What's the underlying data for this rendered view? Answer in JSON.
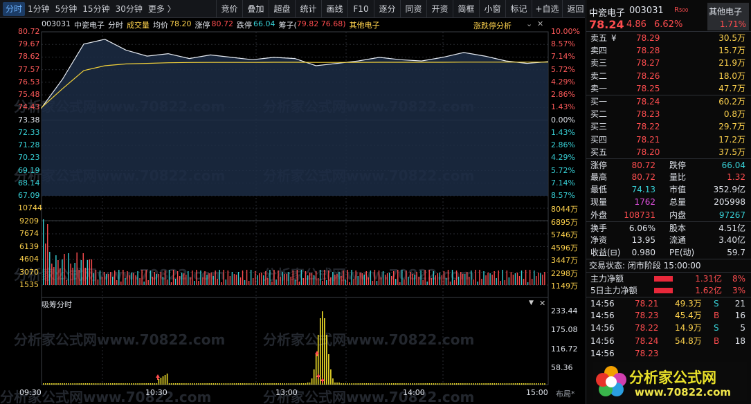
{
  "toolbar": {
    "tabs": [
      "分时",
      "1分钟",
      "5分钟",
      "15分钟",
      "30分钟",
      "更多 〉"
    ],
    "tools": [
      "竞价",
      "叠加",
      "超盘",
      "统计",
      "画线",
      "F10",
      "逐分",
      "同资",
      "开资",
      "简框",
      "小窗",
      "标记",
      "+自选",
      "返回"
    ]
  },
  "info": {
    "code": "003031",
    "name": "中瓷电子",
    "mode": "分时",
    "vol_label": "成交量",
    "avg_label": "均价",
    "avg": "78.20",
    "limit_up_label": "涨停",
    "limit_up": "80.72",
    "limit_down_label": "跌停",
    "limit_down": "66.04",
    "chip_label": "筹子(",
    "chip": "79.82 76.68)",
    "sector": "其他电子",
    "btn": "涨跌停分析"
  },
  "price_axis": {
    "left": [
      "80.72",
      "79.67",
      "78.62",
      "77.57",
      "76.53",
      "75.48",
      "74.43",
      "73.38",
      "72.33",
      "71.28",
      "70.23",
      "69.19",
      "68.14",
      "67.09"
    ],
    "right": [
      "10.00%",
      "8.57%",
      "7.14%",
      "5.72%",
      "4.29%",
      "2.86%",
      "1.43%",
      "0.00%",
      "1.43%",
      "2.86%",
      "4.29%",
      "5.72%",
      "7.14%",
      "8.57%"
    ]
  },
  "vol_axis": {
    "left": [
      "10744",
      "9209",
      "7674",
      "6139",
      "4604",
      "3070",
      "1535"
    ],
    "right": [
      "8044万",
      "6895万",
      "5746万",
      "4596万",
      "3447万",
      "2298万",
      "1149万"
    ]
  },
  "chip_panel": {
    "title": "吸筹分时",
    "axis": [
      "233.44",
      "175.08",
      "116.72",
      "58.36"
    ]
  },
  "time_axis": [
    "09:30",
    "10:30",
    "13:00",
    "14:00",
    "15:00"
  ],
  "layout_btn": "布局*",
  "watermark": "分析家公式网www.70822.com",
  "logo_text": "分析家公式网",
  "logo_url": "www.70822.com",
  "stock": {
    "name": "中瓷电子",
    "code": "003031",
    "tag": "R",
    "tag2": "500",
    "price": "78.24",
    "change": "4.86",
    "pct": "6.62%",
    "sector": "其他电子",
    "sector_pct": "1.71%"
  },
  "asks": [
    {
      "l": "卖五",
      "p": "78.29",
      "v": "30.5万",
      "mark": "¥"
    },
    {
      "l": "卖四",
      "p": "78.28",
      "v": "15.7万"
    },
    {
      "l": "卖三",
      "p": "78.27",
      "v": "21.9万"
    },
    {
      "l": "卖二",
      "p": "78.26",
      "v": "18.0万"
    },
    {
      "l": "卖一",
      "p": "78.25",
      "v": "47.7万"
    }
  ],
  "bids": [
    {
      "l": "买一",
      "p": "78.24",
      "v": "60.2万"
    },
    {
      "l": "买二",
      "p": "78.23",
      "v": "0.8万"
    },
    {
      "l": "买三",
      "p": "78.22",
      "v": "29.7万"
    },
    {
      "l": "买四",
      "p": "78.21",
      "v": "17.2万"
    },
    {
      "l": "买五",
      "p": "78.20",
      "v": "37.5万"
    }
  ],
  "stats": [
    [
      "涨停",
      "80.72",
      "跌停",
      "66.04"
    ],
    [
      "最高",
      "80.72",
      "量比",
      "1.32"
    ],
    [
      "最低",
      "74.13",
      "市值",
      "352.9亿"
    ],
    [
      "现量",
      "1762",
      "总量",
      "205998"
    ],
    [
      "外盘",
      "108731",
      "内盘",
      "97267"
    ]
  ],
  "stats2": [
    [
      "换手",
      "6.06%",
      "股本",
      "4.51亿"
    ],
    [
      "净资",
      "13.95",
      "流通",
      "3.40亿"
    ],
    [
      "收益(⊟)",
      "0.980",
      "PE(动)",
      "59.7"
    ]
  ],
  "status": "交易状态: 闭市阶段 15:00:00",
  "flows": [
    {
      "l": "主力净额",
      "v": "1.31亿",
      "p": "8%"
    },
    {
      "l": "5日主力净额",
      "v": "1.62亿",
      "p": "3%"
    }
  ],
  "ticks": [
    [
      "14:56",
      "78.21",
      "49.3万",
      "S",
      "21"
    ],
    [
      "14:56",
      "78.23",
      "45.4万",
      "B",
      "16"
    ],
    [
      "14:56",
      "78.22",
      "14.9万",
      "S",
      "5"
    ],
    [
      "14:56",
      "78.24",
      "54.8万",
      "B",
      "18"
    ],
    [
      "14:56",
      "78.23",
      "",
      "",
      ""
    ]
  ],
  "chart_data": {
    "type": "line",
    "title": "中瓷电子 003031 分时",
    "prev_close": 73.38,
    "ylim": [
      67.09,
      80.72
    ],
    "x": [
      "09:30",
      "10:30",
      "13:00",
      "14:00",
      "15:00"
    ],
    "series": [
      {
        "name": "价格",
        "values": [
          74.4,
          76.8,
          79.7,
          80.1,
          79.2,
          78.7,
          78.9,
          78.5,
          78.8,
          78.6,
          78.4,
          78.6,
          78.5,
          77.9,
          78.1,
          78.3,
          78.6,
          78.4,
          78.3,
          78.6,
          79.0,
          78.7,
          78.3,
          78.1,
          78.24
        ]
      },
      {
        "name": "均价",
        "values": [
          74.43,
          76.0,
          77.5,
          77.9,
          78.05,
          78.1,
          78.15,
          78.17,
          78.18,
          78.18,
          78.18,
          78.19,
          78.19,
          78.18,
          78.18,
          78.18,
          78.19,
          78.19,
          78.19,
          78.19,
          78.2,
          78.2,
          78.2,
          78.2,
          78.2
        ]
      }
    ]
  }
}
